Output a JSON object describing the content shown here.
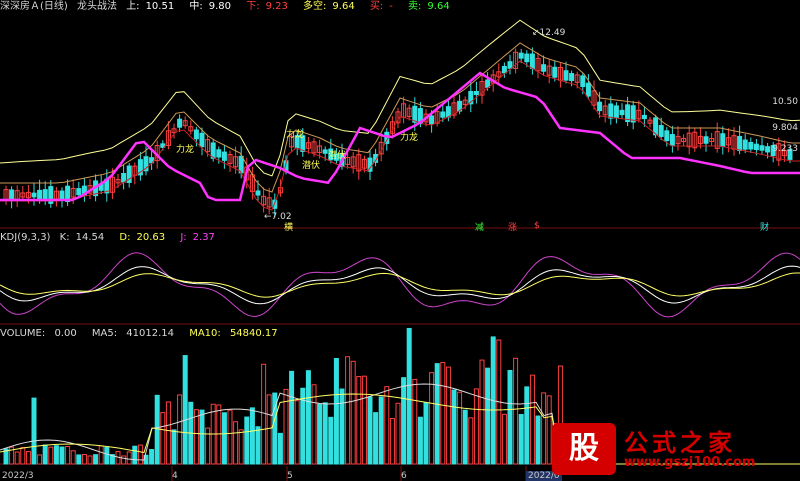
{
  "main_header": {
    "title": "深深房Ａ(日线)",
    "indicator": "龙头战法",
    "up_label": "上:",
    "up_value": "10.51",
    "mid_label": "中:",
    "mid_value": "9.80",
    "down_label": "下:",
    "down_value": "9.23",
    "duokong_label": "多空:",
    "duokong_value": "9.64",
    "buy_label": "买:",
    "buy_value": "-",
    "sell_label": "卖:",
    "sell_value": "9.64"
  },
  "price_labels": [
    "10.50",
    "9.804",
    "9.233"
  ],
  "annotations": {
    "high": "12.49",
    "low": "7.02",
    "li_long": "力龙",
    "qianfu": "潜伏",
    "marker_1": "横",
    "marker_2": "减",
    "marker_3": "涨",
    "marker_4": "$",
    "marker_5": "财"
  },
  "kdj_header": {
    "name": "KDJ(9,3,3)",
    "k_label": "K:",
    "k_value": "14.54",
    "d_label": "D:",
    "d_value": "20.63",
    "j_label": "J:",
    "j_value": "2.37"
  },
  "vol_header": {
    "name": "VOLUME:",
    "volume_value": "0.00",
    "ma5_label": "MA5:",
    "ma5_value": "41012.14",
    "ma10_label": "MA10:",
    "ma10_value": "54840.17"
  },
  "x_axis": [
    "2022/3",
    "4",
    "5",
    "6",
    "2022/0"
  ],
  "watermark": {
    "logo": "股",
    "site_name": "公式之家",
    "url": "www.gszj100.com"
  },
  "colors": {
    "up": "#ff4040",
    "down": "#33e0e0",
    "band": "#ffff99",
    "ma_long": "#ff33ff",
    "kdj_k": "#ffffff",
    "kdj_d": "#ffff66",
    "kdj_j": "#cc44cc"
  }
}
